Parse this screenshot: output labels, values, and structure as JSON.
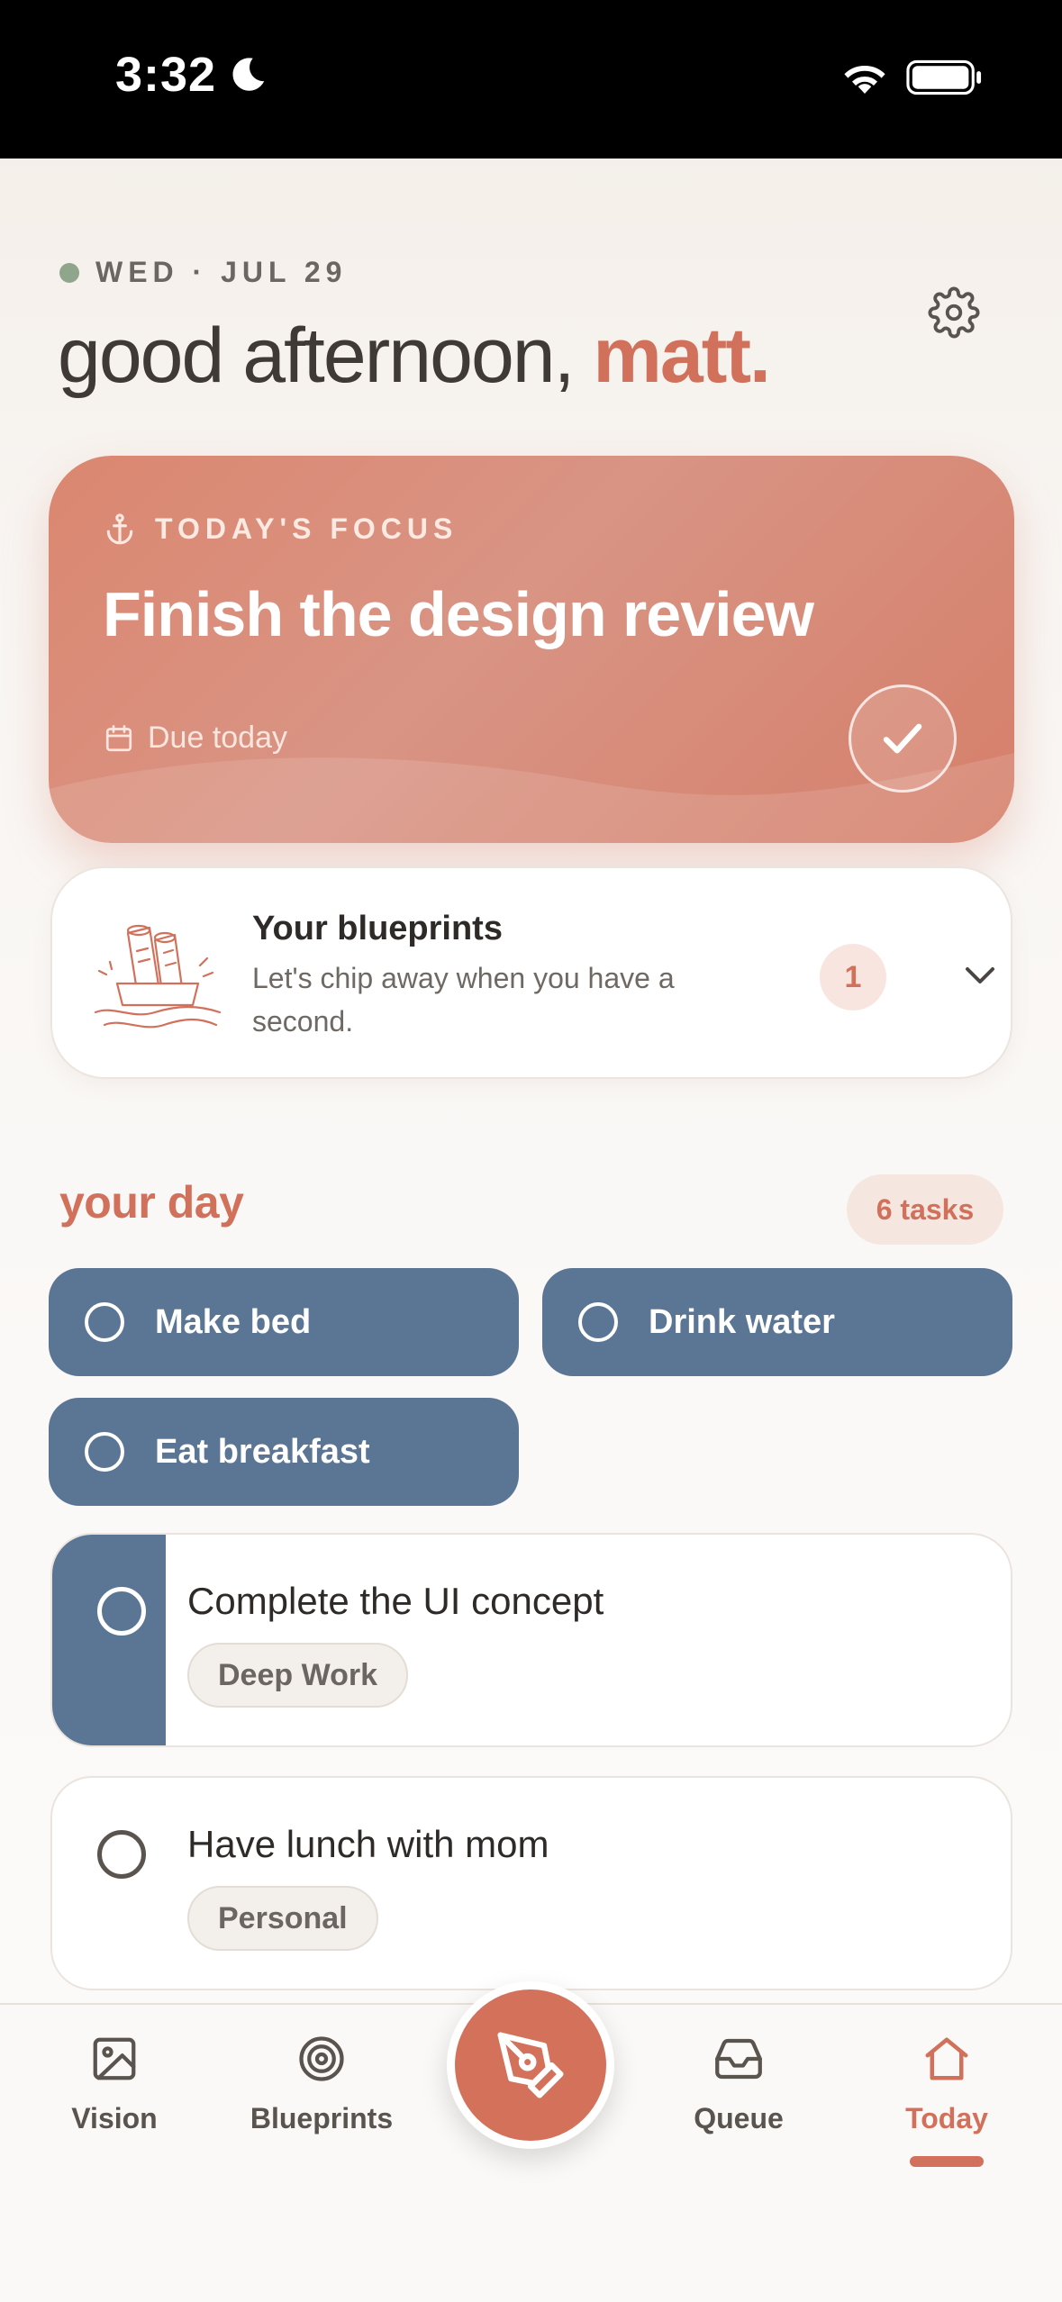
{
  "status_bar": {
    "time": "3:32"
  },
  "header": {
    "date": "WED · JUL 29",
    "greeting": "good afternoon, ",
    "name": "matt."
  },
  "focus": {
    "label": "TODAY'S FOCUS",
    "title": "Finish the design review",
    "due": "Due today"
  },
  "blueprints": {
    "title": "Your blueprints",
    "subtitle": "Let's chip away when you have a second.",
    "count": "1"
  },
  "day": {
    "title": "your day",
    "task_count": "6 tasks",
    "chips": [
      {
        "label": "Make bed"
      },
      {
        "label": "Drink water"
      },
      {
        "label": "Eat breakfast"
      }
    ],
    "tasks": [
      {
        "title": "Complete the UI concept",
        "tag": "Deep Work"
      },
      {
        "title": "Have lunch with mom",
        "tag": "Personal"
      }
    ]
  },
  "nav": {
    "items": [
      {
        "label": "Vision",
        "icon": "image-icon"
      },
      {
        "label": "Blueprints",
        "icon": "target-icon"
      },
      {
        "label": "Queue",
        "icon": "inbox-icon"
      },
      {
        "label": "Today",
        "icon": "home-icon"
      }
    ],
    "active": "Today",
    "fab_icon": "pen-nib-icon"
  },
  "colors": {
    "accent": "#d2715b",
    "chip_blue": "#5b7595",
    "focus_card": "#d98a76"
  }
}
